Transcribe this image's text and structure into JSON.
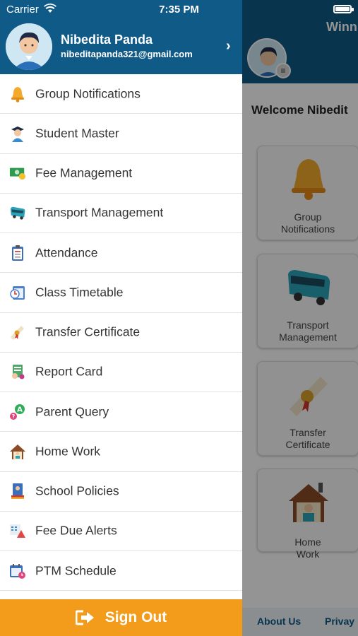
{
  "status_bar": {
    "carrier": "Carrier",
    "time": "7:35 PM"
  },
  "drawer": {
    "user_name": "Nibedita Panda",
    "user_email": "nibeditapanda321@gmail.com",
    "menu_items": [
      {
        "label": "Group Notifications",
        "icon": "bell-icon"
      },
      {
        "label": "Student Master",
        "icon": "student-icon"
      },
      {
        "label": "Fee Management",
        "icon": "money-icon"
      },
      {
        "label": "Transport Management",
        "icon": "bus-icon"
      },
      {
        "label": "Attendance",
        "icon": "clipboard-icon"
      },
      {
        "label": "Class Timetable",
        "icon": "timetable-icon"
      },
      {
        "label": "Transfer Certificate",
        "icon": "certificate-icon"
      },
      {
        "label": "Report Card",
        "icon": "report-card-icon"
      },
      {
        "label": "Parent Query",
        "icon": "query-icon"
      },
      {
        "label": "Home Work",
        "icon": "home-icon"
      },
      {
        "label": "School Policies",
        "icon": "policy-book-icon"
      },
      {
        "label": "Fee Due Alerts",
        "icon": "alert-icon"
      },
      {
        "label": "PTM Schedule",
        "icon": "calendar-icon"
      }
    ],
    "sign_out_label": "Sign Out"
  },
  "background": {
    "title": "Winn",
    "welcome": "Welcome Nibedit",
    "cards": [
      {
        "label": "Group Notifications",
        "icon": "bell-icon"
      },
      {
        "label": "Transport Management",
        "icon": "bus-icon"
      },
      {
        "label": "Transfer Certificate",
        "icon": "certificate-icon"
      },
      {
        "label": "Home Work",
        "icon": "home-icon"
      }
    ],
    "footer_links": [
      "About Us",
      "Privay"
    ]
  },
  "colors": {
    "brand": "#0f5a86",
    "signout": "#f39c1c"
  }
}
